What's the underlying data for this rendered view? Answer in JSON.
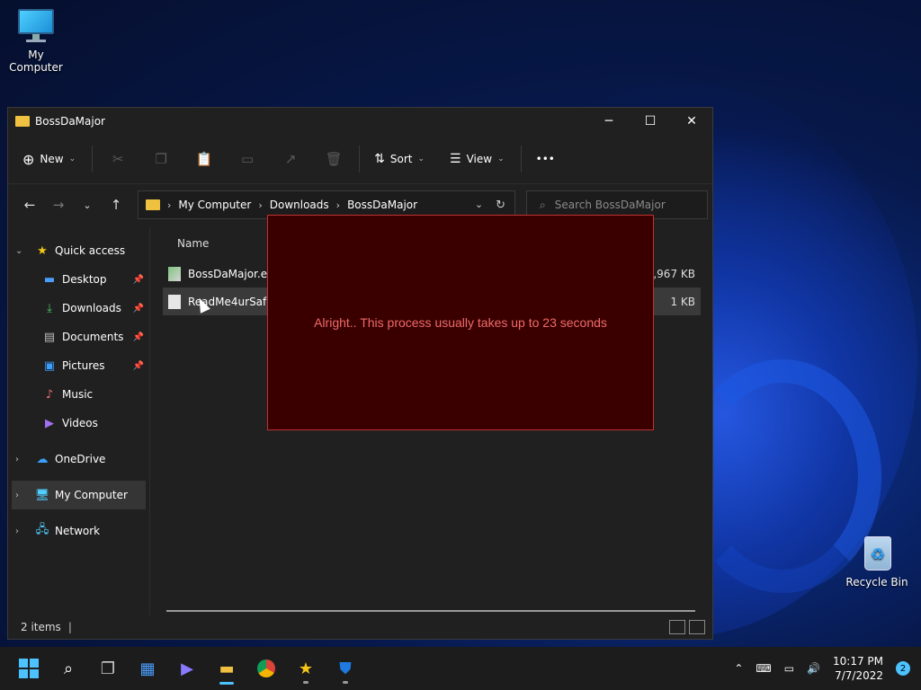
{
  "desktop": {
    "icons": [
      {
        "label": "My Computer"
      },
      {
        "label": "Recycle Bin"
      }
    ]
  },
  "window": {
    "title": "BossDaMajor",
    "controls": {
      "minimize": "─",
      "maximize": "☐",
      "close": "✕"
    }
  },
  "toolbar": {
    "new_label": "New",
    "sort_label": "Sort",
    "view_label": "View",
    "more_label": "•••"
  },
  "address": {
    "crumbs": [
      "My Computer",
      "Downloads",
      "BossDaMajor"
    ],
    "search_placeholder": "Search BossDaMajor"
  },
  "sidebar": {
    "items": [
      {
        "label": "Quick access"
      },
      {
        "label": "Desktop"
      },
      {
        "label": "Downloads"
      },
      {
        "label": "Documents"
      },
      {
        "label": "Pictures"
      },
      {
        "label": "Music"
      },
      {
        "label": "Videos"
      },
      {
        "label": "OneDrive"
      },
      {
        "label": "My Computer"
      },
      {
        "label": "Network"
      }
    ]
  },
  "filelist": {
    "column_name": "Name",
    "files": [
      {
        "name": "BossDaMajor.exe",
        "size": "1,967 KB"
      },
      {
        "name": "ReadMe4urSafety",
        "size": "1 KB"
      }
    ]
  },
  "status": {
    "count": "2 items"
  },
  "overlay": {
    "message": "Alright.. This process usually takes up to 23 seconds"
  },
  "taskbar": {
    "time": "10:17 PM",
    "date": "7/7/2022",
    "notifications": "2"
  },
  "colors": {
    "overlay_bg": "#3a0000",
    "overlay_text": "#ef6a6a",
    "accent": "#4cc2ff"
  }
}
